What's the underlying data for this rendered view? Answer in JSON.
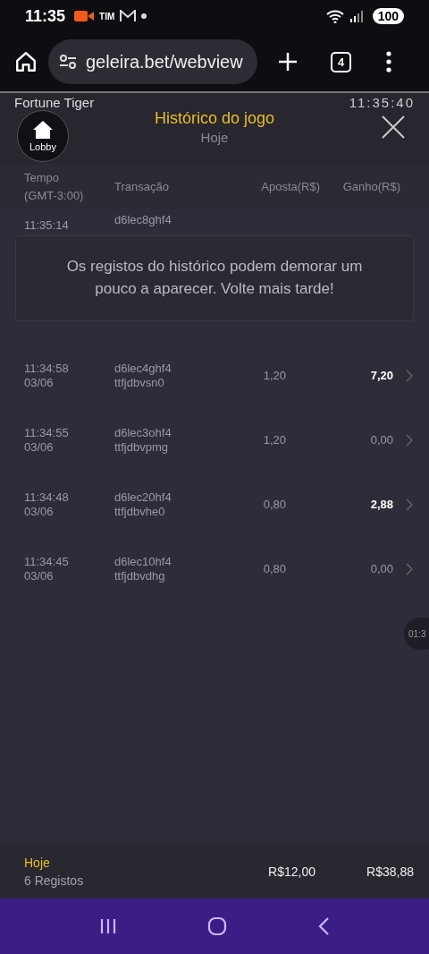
{
  "status_bar": {
    "time": "11:35",
    "carrier": "TIM",
    "battery": "100"
  },
  "browser": {
    "url": "geleira.bet/webview",
    "tab_count": "4"
  },
  "game": {
    "name": "Fortune Tiger",
    "clock": "11:35:40",
    "lobby": "Lobby",
    "title": "Histórico do jogo",
    "subtitle": "Hoje"
  },
  "table": {
    "columns": [
      "Tempo (GMT-3:00)",
      "Transação",
      "Aposta(R$)",
      "Ganho(R$)"
    ],
    "rows": [
      {
        "kind": "partial",
        "time": "11:35:14",
        "transaction": "d6lec8ghf4"
      },
      {
        "kind": "full",
        "time": "11:34:58",
        "date": "03/06",
        "transaction": "d6lec4ghf4",
        "transaction_2": "ttfjdbvsn0",
        "bet": "1,20",
        "win": "7,20",
        "highlighted": true
      },
      {
        "kind": "full",
        "time": "11:34:55",
        "date": "03/06",
        "transaction": "d6lec3ohf4",
        "transaction_2": "ttfjdbvpmg",
        "bet": "1,20",
        "win": "0,00",
        "highlighted": false
      },
      {
        "kind": "full",
        "time": "11:34:48",
        "date": "03/06",
        "transaction": "d6lec20hf4",
        "transaction_2": "ttfjdbvhe0",
        "bet": "0,80",
        "win": "2,88",
        "highlighted": true
      },
      {
        "kind": "full",
        "time": "11:34:45",
        "date": "03/06",
        "transaction": "d6lec10hf4",
        "transaction_2": "ttfjdbvdhg",
        "bet": "0,80",
        "win": "0,00",
        "highlighted": false
      }
    ]
  },
  "toast": "Os registos do histórico podem demorar um pouco a aparecer. Volte mais tarde!",
  "floating_timer": "01:3",
  "footer": {
    "period": "Hoje",
    "count": "6 Registos",
    "total_bet": "R$12,00",
    "total_win": "R$38,88"
  }
}
